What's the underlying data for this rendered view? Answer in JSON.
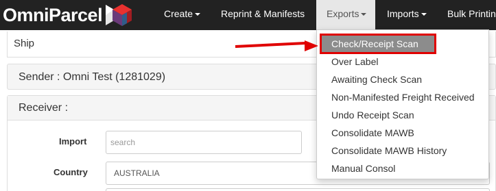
{
  "brand": {
    "name": "OmniParcel"
  },
  "nav": {
    "items": [
      {
        "label": "Create",
        "caret": true
      },
      {
        "label": "Reprint & Manifests",
        "caret": false
      },
      {
        "label": "Exports",
        "caret": true,
        "active": true
      },
      {
        "label": "Imports",
        "caret": true
      },
      {
        "label": "Bulk Printin",
        "caret": false
      }
    ]
  },
  "ship": {
    "title": "Ship"
  },
  "sender": {
    "title": "Sender : Omni Test (1281029)"
  },
  "receiver": {
    "title": "Receiver :",
    "import_label": "Import",
    "import_placeholder": "search",
    "country_label": "Country",
    "country_value": "AUSTRALIA"
  },
  "exports_menu": {
    "items": [
      {
        "label": "Check/Receipt Scan",
        "highlighted": true
      },
      {
        "label": "Over Label"
      },
      {
        "label": "Awaiting Check Scan"
      },
      {
        "label": "Non-Manifested Freight Received"
      },
      {
        "label": "Undo Receipt Scan"
      },
      {
        "label": "Consolidate MAWB"
      },
      {
        "label": "Consolidate MAWB History"
      },
      {
        "label": "Manual Consol"
      }
    ]
  },
  "colors": {
    "navbar_bg": "#222222",
    "annotation_red": "#e00000",
    "highlight_bg": "#8c8c8c",
    "logo_red": "#e8312f",
    "logo_dark_red": "#a01d22",
    "logo_purple": "#6b3a7a",
    "logo_blue": "#2f5d8a"
  }
}
